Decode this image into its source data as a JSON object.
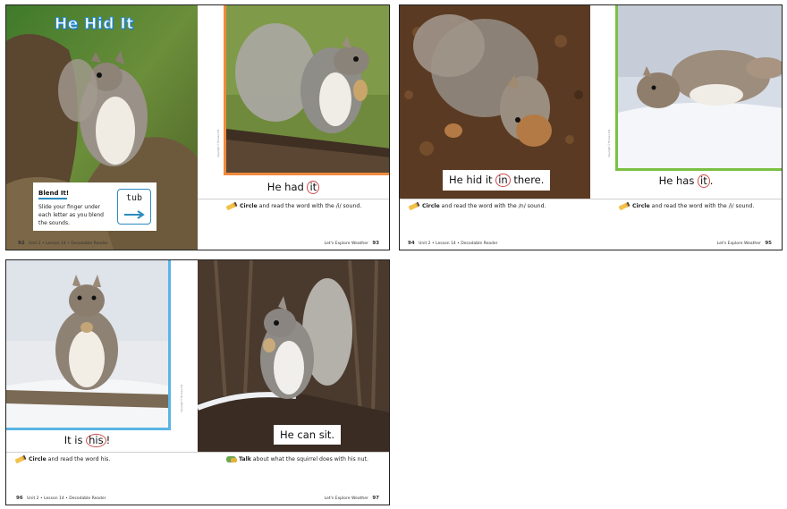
{
  "colors": {
    "frame_orange": "#f08a3c",
    "frame_green": "#7bc043",
    "frame_blue": "#5ab4e5",
    "circle_red": "#d04a4a",
    "accent_blue": "#2b8bbf"
  },
  "spread1": {
    "title": "He Hid It",
    "blend": {
      "title": "Blend It!",
      "text": "Slide your finger under each letter as you blend the sounds.",
      "word": "tub"
    },
    "caption_pre": "He had ",
    "caption_circled": "it",
    "instr_bold": "Circle",
    "instr_text": " and read the word with the /i/ sound.",
    "footer_left_num": "92",
    "footer_left_text": "Unit 2 • Lesson 14 • Decodable Reader",
    "footer_right_text": "Let's Explore Weather",
    "footer_right_num": "93",
    "side_note": "Copyright © McGraw Hill"
  },
  "spread2": {
    "caption_left_pre": "He hid it ",
    "caption_left_circled": "in",
    "caption_left_post": " there.",
    "caption_right_pre": "He has ",
    "caption_right_circled": "it",
    "caption_right_post": ".",
    "instr_bold": "Circle",
    "instr_text_left": " and read the word with the /n/ sound.",
    "instr_text_right": " and read the word with the /i/ sound.",
    "footer_left_num": "94",
    "footer_left_text": "Unit 2 • Lesson 14 • Decodable Reader",
    "footer_right_text": "Let's Explore Weather",
    "footer_right_num": "95",
    "side_note": "Copyright © McGraw Hill"
  },
  "spread3": {
    "caption_left_pre": "It is ",
    "caption_left_circled": "his",
    "caption_left_post": "!",
    "caption_right": "He can sit.",
    "instr_left_bold": "Circle",
    "instr_left_text": " and read the word his.",
    "instr_right_bold": "Talk",
    "instr_right_text": " about what the squirrel does with his nut.",
    "footer_left_num": "96",
    "footer_left_text": "Unit 2 • Lesson 14 • Decodable Reader",
    "footer_right_text": "Let's Explore Weather",
    "footer_right_num": "97",
    "side_note": "Copyright © McGraw Hill"
  }
}
